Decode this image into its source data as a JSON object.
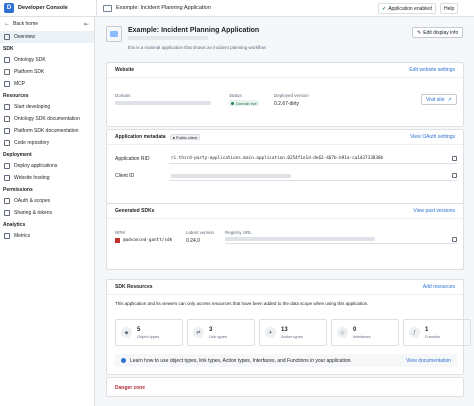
{
  "topbar": {
    "app_name": "Developer Console",
    "breadcrumb": "Example: Incident Planning Application",
    "status": "Application enabled",
    "help": "Help"
  },
  "sidebar": {
    "back_label": "Back home",
    "overview": "Overview",
    "sections": [
      {
        "title": "SDK",
        "items": [
          "Ontology SDK",
          "Platform SDK",
          "MCP"
        ]
      },
      {
        "title": "Resources",
        "items": [
          "Start developing",
          "Ontology SDK documentation",
          "Platform SDK documentation",
          "Code repository"
        ]
      },
      {
        "title": "Deployment",
        "items": [
          "Deploy applications",
          "Website hosting"
        ]
      },
      {
        "title": "Permissions",
        "items": [
          "OAuth & scopes",
          "Sharing & tokens"
        ]
      },
      {
        "title": "Analytics",
        "items": [
          "Metrics"
        ]
      }
    ]
  },
  "app": {
    "title": "Example: Incident Planning Application",
    "description": "this is a notional application that shows an incident planning workflow",
    "edit_label": "Edit display info"
  },
  "website": {
    "title": "Website",
    "link": "Edit website settings",
    "domain_label": "Domain",
    "status_label": "Status",
    "status_value": "Domain live",
    "deployed_label": "Deployed version",
    "deployed_value": "0.2.67-dirty",
    "visit_label": "Visit site"
  },
  "metadata": {
    "title": "Application metadata",
    "tag": "Public client",
    "link": "View OAuth settings",
    "rid_label": "Application RID",
    "rid_value": "ri.third-party-applications.main.application.0254f1e1d-de62-467b-b91a-ca1d3733838b",
    "client_label": "Client ID"
  },
  "sdks": {
    "title": "Generated SDKs",
    "link": "View past versions",
    "npm_label": "NPM",
    "package": "@advanced-gantt/sdk",
    "latest_label": "Latest version",
    "latest_value": "0.24.0",
    "registry_label": "Registry URL"
  },
  "resources": {
    "title": "SDK Resources",
    "link": "Add resources",
    "desc": "This application and its viewers can only access resources that have been added to the data scope when using this application.",
    "types": [
      {
        "count": "5",
        "label": "Object types",
        "icon": "cube-icon"
      },
      {
        "count": "3",
        "label": "Link types",
        "icon": "link-icon"
      },
      {
        "count": "13",
        "label": "Action types",
        "icon": "action-icon"
      },
      {
        "count": "0",
        "label": "Interfaces",
        "icon": "interface-icon"
      },
      {
        "count": "1",
        "label": "Function",
        "icon": "function-icon"
      }
    ],
    "info": "Learn how to use object types, link types, Action types, Interfaces, and Functions in your application.",
    "docs_link": "View documentation"
  },
  "danger": {
    "title": "Danger zone"
  }
}
